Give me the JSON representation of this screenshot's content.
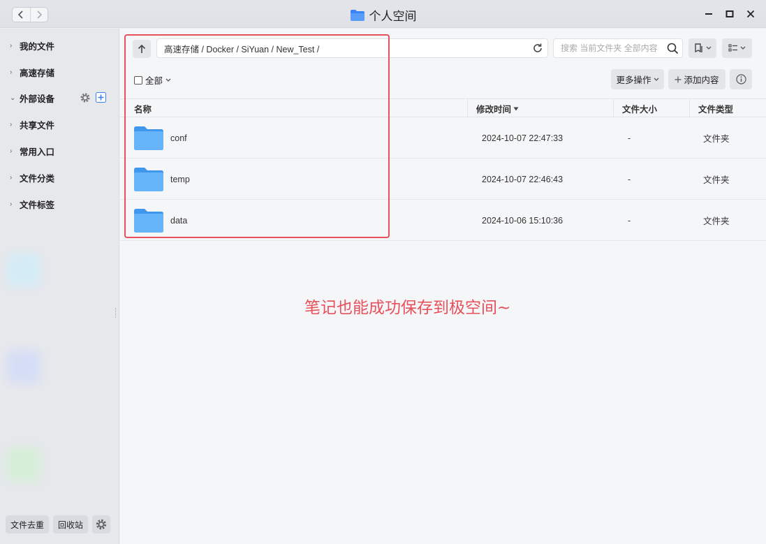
{
  "window": {
    "title": "个人空间"
  },
  "sidebar": {
    "items": [
      {
        "label": "我的文件",
        "expanded": false
      },
      {
        "label": "高速存储",
        "expanded": false
      },
      {
        "label": "外部设备",
        "expanded": true
      },
      {
        "label": "共享文件",
        "expanded": false
      },
      {
        "label": "常用入口",
        "expanded": false
      },
      {
        "label": "文件分类",
        "expanded": false
      },
      {
        "label": "文件标签",
        "expanded": false
      }
    ],
    "bottom": {
      "dedupe_label": "文件去重",
      "recycle_label": "回收站"
    }
  },
  "toolbar": {
    "path": "高速存储 / Docker / SiYuan / New_Test /",
    "search_placeholder": "搜索 当前文件夹 全部内容",
    "select_all_label": "全部",
    "more_actions_label": "更多操作",
    "add_content_label": "添加内容"
  },
  "table": {
    "columns": {
      "name": "名称",
      "modified": "修改时间",
      "size": "文件大小",
      "type": "文件类型"
    },
    "rows": [
      {
        "name": "conf",
        "modified": "2024-10-07 22:47:33",
        "size": "-",
        "type": "文件夹"
      },
      {
        "name": "temp",
        "modified": "2024-10-07 22:46:43",
        "size": "-",
        "type": "文件夹"
      },
      {
        "name": "data",
        "modified": "2024-10-06 15:10:36",
        "size": "-",
        "type": "文件夹"
      }
    ]
  },
  "annotation": {
    "text": "笔记也能成功保存到极空间~",
    "color": "#e8505b"
  },
  "colors": {
    "folder": "#5aabf5",
    "accent": "#3b82f6"
  }
}
